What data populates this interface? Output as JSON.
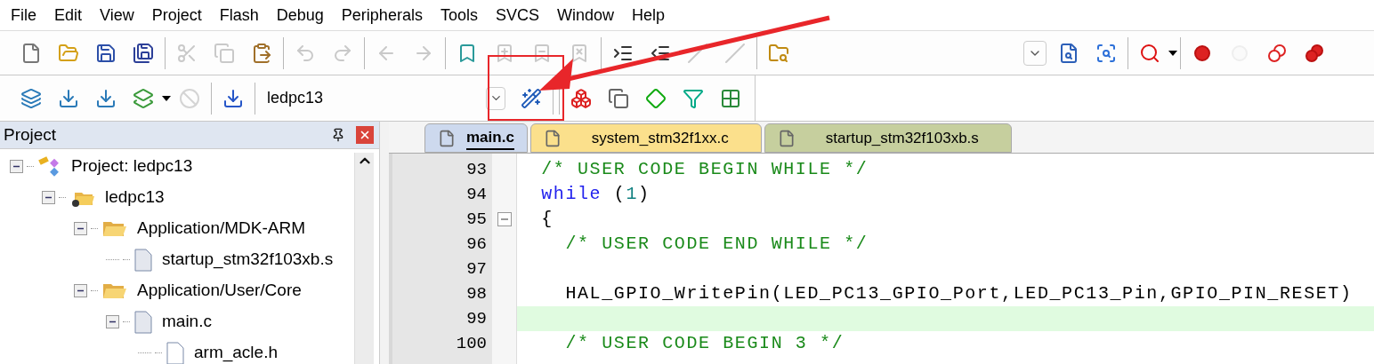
{
  "menu": [
    "File",
    "Edit",
    "View",
    "Project",
    "Flash",
    "Debug",
    "Peripherals",
    "Tools",
    "SVCS",
    "Window",
    "Help"
  ],
  "toolbar_1": {
    "groups": [
      [
        {
          "disabled": false
        },
        {
          "disabled": false
        },
        {
          "disabled": false
        },
        {
          "disabled": false
        }
      ],
      [
        {
          "disabled": true
        },
        {
          "disabled": true
        },
        {
          "disabled": false
        }
      ],
      [
        {
          "disabled": true
        },
        {
          "disabled": true
        }
      ],
      [
        {
          "disabled": true
        },
        {
          "disabled": true
        }
      ],
      [
        {
          "disabled": false
        },
        {
          "disabled": true
        },
        {
          "disabled": true
        },
        {
          "disabled": true
        }
      ],
      [
        {
          "disabled": false
        },
        {
          "disabled": false
        },
        {
          "disabled": true
        },
        {
          "disabled": true
        }
      ],
      [
        {
          "disabled": false
        }
      ],
      [
        {
          "disabled": false
        },
        {
          "disabled": false
        },
        {
          "disabled": false
        }
      ],
      [
        {
          "disabled": false
        }
      ],
      [
        {
          "disabled": false
        },
        {
          "disabled": true
        },
        {
          "disabled": false
        },
        {
          "disabled": false
        }
      ]
    ]
  },
  "toolbar_2": {
    "groups": [
      [
        {
          "disabled": false
        },
        {
          "disabled": false
        },
        {
          "disabled": false
        },
        {
          "disabled": false
        },
        {
          "disabled": true
        }
      ],
      [
        {
          "disabled": false
        }
      ],
      [
        {
          "disabled": false
        }
      ],
      [
        {
          "disabled": false
        },
        {
          "disabled": false
        },
        {
          "disabled": false
        },
        {
          "disabled": false
        },
        {
          "disabled": false
        }
      ]
    ],
    "target": "ledpc13"
  },
  "project_panel": {
    "title": "Project",
    "tree": [
      {
        "kind": "project",
        "label": "Project: ledpc13",
        "expanded": true,
        "children": [
          {
            "kind": "target",
            "label": "ledpc13",
            "expanded": true,
            "children": [
              {
                "kind": "folder",
                "label": "Application/MDK-ARM",
                "expanded": true,
                "children": [
                  {
                    "kind": "file",
                    "label": "startup_stm32f103xb.s"
                  }
                ]
              },
              {
                "kind": "folder",
                "label": "Application/User/Core",
                "expanded": true,
                "children": [
                  {
                    "kind": "file",
                    "label": "main.c",
                    "expanded": true,
                    "children": [
                      {
                        "kind": "header",
                        "label": "arm_acle.h"
                      }
                    ]
                  }
                ]
              }
            ]
          }
        ]
      }
    ]
  },
  "editor": {
    "tabs": [
      {
        "label": "main.c",
        "selected": true,
        "color": "#cdd9ee"
      },
      {
        "label": "system_stm32f1xx.c",
        "selected": false,
        "color": "#fbe08c"
      },
      {
        "label": "startup_stm32f103xb.s",
        "selected": false,
        "color": "#c6cf9e"
      }
    ],
    "lines": [
      {
        "number": "93",
        "highlighted": false,
        "segments": [
          {
            "kind": "comment",
            "text": "  /* USER CODE BEGIN WHILE */"
          }
        ]
      },
      {
        "number": "94",
        "highlighted": false,
        "segments": [
          {
            "kind": "keyword",
            "text": "  while"
          },
          {
            "kind": "plain",
            "text": " ("
          },
          {
            "kind": "number",
            "text": "1"
          },
          {
            "kind": "plain",
            "text": ")"
          }
        ]
      },
      {
        "number": "95",
        "fold": true,
        "highlighted": false,
        "segments": [
          {
            "kind": "plain",
            "text": "  {"
          }
        ]
      },
      {
        "number": "96",
        "highlighted": false,
        "segments": [
          {
            "kind": "comment",
            "text": "    /* USER CODE END WHILE */"
          }
        ]
      },
      {
        "number": "97",
        "highlighted": false
      },
      {
        "number": "98",
        "highlighted": false,
        "segments": [
          {
            "kind": "plain",
            "text": "    HAL_GPIO_WritePin(LED_PC13_GPIO_Port,LED_PC13_Pin,GPIO_PIN_RESET)"
          }
        ]
      },
      {
        "number": "99",
        "highlighted": true
      },
      {
        "number": "100",
        "highlighted": false,
        "segments": [
          {
            "kind": "comment",
            "text": "    /* USER CODE BEGIN 3 */"
          }
        ]
      }
    ]
  }
}
